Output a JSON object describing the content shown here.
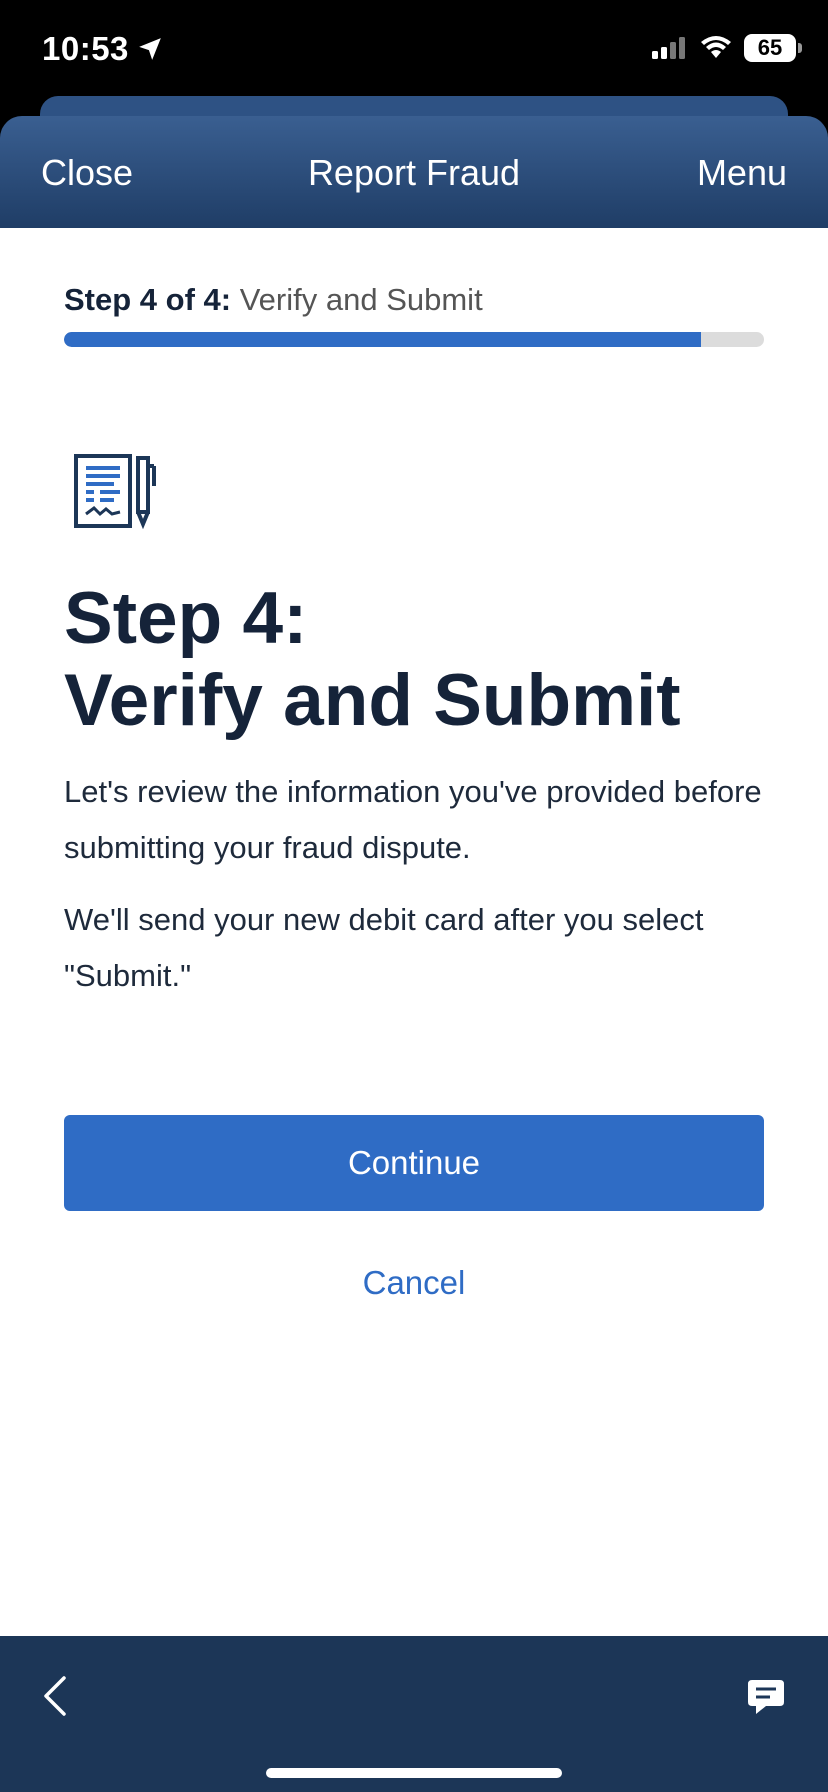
{
  "status_bar": {
    "time": "10:53",
    "battery": "65"
  },
  "header": {
    "close_label": "Close",
    "title": "Report Fraud",
    "menu_label": "Menu"
  },
  "step": {
    "step_bold": "Step 4 of 4:",
    "step_text": "Verify and Submit",
    "progress": 0.91
  },
  "main": {
    "heading_line1": "Step 4:",
    "heading_line2": "Verify and Submit",
    "paragraph1": "Let's review the information you've provided before submitting your fraud dispute.",
    "paragraph2": "We'll send your new debit card after you select \"Submit.\"",
    "continue_label": "Continue",
    "cancel_label": "Cancel"
  },
  "icons": {
    "document": "document-signature-icon",
    "back": "chevron-left-icon",
    "chat": "chat-bubble-icon"
  },
  "colors": {
    "accent": "#2f6cc5",
    "header": "#2a4b7a",
    "bottom_bar": "#1c3657",
    "heading": "#152339"
  }
}
